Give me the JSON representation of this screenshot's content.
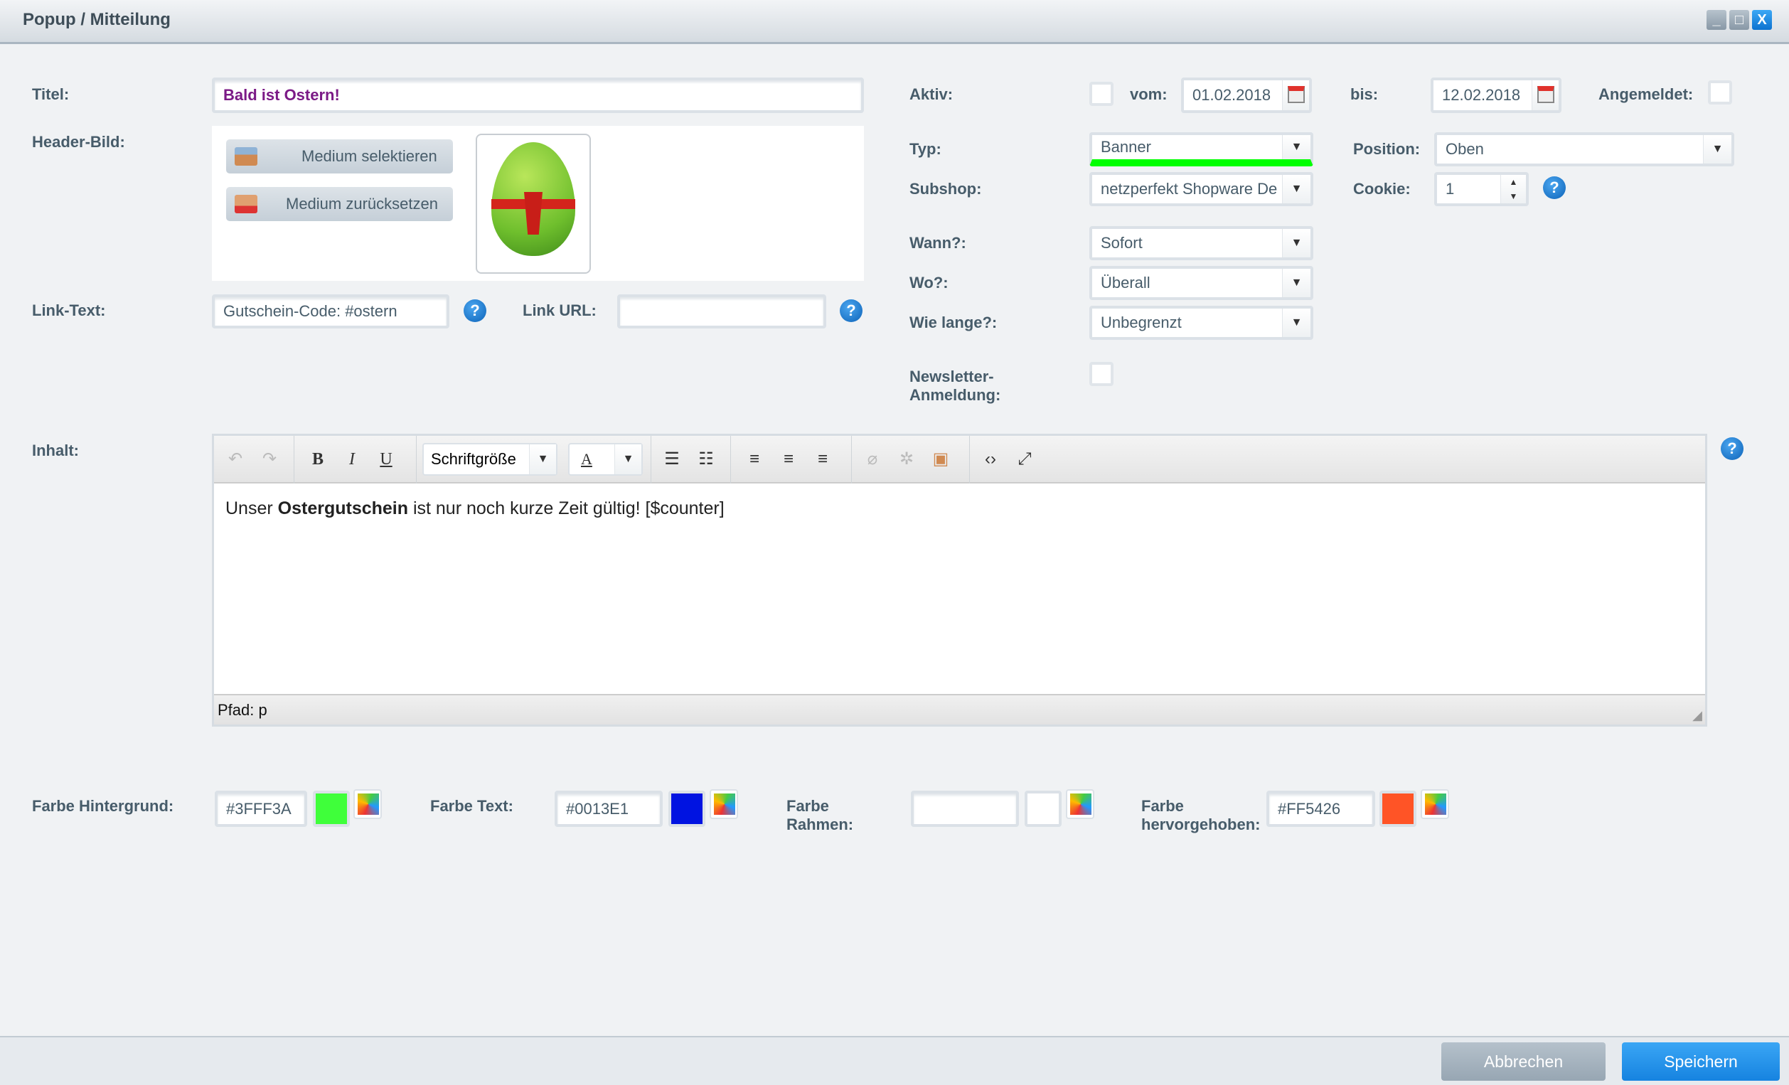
{
  "window": {
    "title": "Popup / Mitteilung"
  },
  "form": {
    "titel_label": "Titel:",
    "titel_value": "Bald ist Ostern!",
    "header_bild_label": "Header-Bild:",
    "select_media": "Medium selektieren",
    "reset_media": "Medium zurücksetzen",
    "link_text_label": "Link-Text:",
    "link_text_value": "Gutschein-Code: #ostern",
    "link_url_label": "Link URL:",
    "link_url_value": "",
    "aktiv_label": "Aktiv:",
    "vom_label": "vom:",
    "vom_value": "01.02.2018",
    "bis_label": "bis:",
    "bis_value": "12.02.2018",
    "angemeldet_label": "Angemeldet:",
    "typ_label": "Typ:",
    "typ_value": "Banner",
    "position_label": "Position:",
    "position_value": "Oben",
    "subshop_label": "Subshop:",
    "subshop_value": "netzperfekt Shopware De",
    "cookie_label": "Cookie:",
    "cookie_value": "1",
    "wann_label": "Wann?:",
    "wann_value": "Sofort",
    "wo_label": "Wo?:",
    "wo_value": "Überall",
    "wie_lange_label": "Wie lange?:",
    "wie_lange_value": "Unbegrenzt",
    "newsletter_label_1": "Newsletter-",
    "newsletter_label_2": "Anmeldung:",
    "inhalt_label": "Inhalt:"
  },
  "editor": {
    "font_size": "Schriftgröße",
    "content_pre": "Unser ",
    "content_bold": "Ostergutschein",
    "content_post": " ist nur noch kurze Zeit gültig! [$counter]",
    "path": "Pfad: p"
  },
  "colors": {
    "bg_label": "Farbe Hintergrund:",
    "bg_value": "#3FFF3A",
    "bg_color": "#3FFF3A",
    "text_label": "Farbe Text:",
    "text_value": "#0013E1",
    "text_color": "#0013E1",
    "border_label_1": "Farbe",
    "border_label_2": "Rahmen:",
    "border_value": "",
    "highlight_label_1": "Farbe",
    "highlight_label_2": "hervorgehoben:",
    "highlight_value": "#FF5426",
    "highlight_color": "#FF5426"
  },
  "footer": {
    "cancel": "Abbrechen",
    "save": "Speichern"
  },
  "accent": {
    "typ_underline": "#00ff00",
    "save_button": "#1a90e8",
    "title_text": "#7b1a86"
  }
}
